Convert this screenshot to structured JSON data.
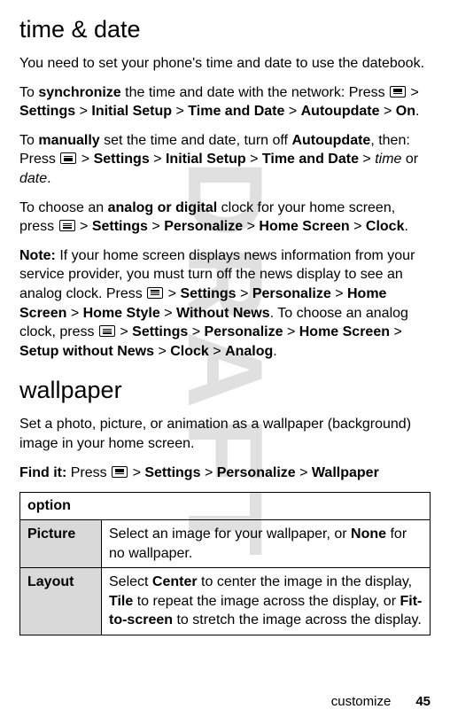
{
  "watermark": "DRAFT",
  "s1": {
    "heading": "time & date",
    "p1": "You need to set your phone's time and date to use the datebook.",
    "p2a": "To ",
    "p2b": "synchronize",
    "p2c": " the time and date with the network: Press ",
    "p2d": "Settings",
    "p2e": "Initial Setup",
    "p2f": "Time and Date",
    "p2g": "Autoupdate",
    "p2h": "On",
    "p3a": "To ",
    "p3b": "manually",
    "p3c": " set the time and date, turn off ",
    "p3d": "Autoupdate",
    "p3e": ", then: Press ",
    "p3f": "Settings",
    "p3g": "Initial Setup",
    "p3h": "Time and Date",
    "p3i": "time",
    "p3j": " or ",
    "p3k": "date",
    "p4a": "To choose an ",
    "p4b": "analog or digital",
    "p4c": " clock for your home screen, press ",
    "p4d": "Settings",
    "p4e": "Personalize",
    "p4f": "Home Screen",
    "p4g": "Clock",
    "p5a": "Note:",
    "p5b": " If your home screen displays news information from your service provider, you must turn off the news display to see an analog clock. Press ",
    "p5c": "Settings",
    "p5d": "Personalize",
    "p5e": "Home Screen",
    "p5f": "Home Style",
    "p5g": "Without News",
    "p5h": ". To choose an analog clock, press ",
    "p5i": "Settings",
    "p5j": "Personalize",
    "p5k": "Home Screen",
    "p5l": "Setup without News",
    "p5m": "Clock",
    "p5n": "Analog"
  },
  "s2": {
    "heading": "wallpaper",
    "p1": "Set a photo, picture, or animation as a wallpaper (background) image in your home screen.",
    "p2a": "Find it:",
    "p2b": " Press ",
    "p2c": "Settings",
    "p2d": "Personalize",
    "p2e": "Wallpaper"
  },
  "table": {
    "header": "option",
    "r1": {
      "label": "Picture",
      "t1": "Select an image for your wallpaper, or ",
      "t2": "None",
      "t3": " for no wallpaper."
    },
    "r2": {
      "label": "Layout",
      "t1": "Select ",
      "t2": "Center",
      "t3": " to center the image in the display, ",
      "t4": "Tile",
      "t5": " to repeat the image across the display, or ",
      "t6": "Fit-to-screen",
      "t7": " to stretch the image across the display."
    }
  },
  "footer": {
    "section": "customize",
    "page": "45"
  },
  "gt": ">"
}
